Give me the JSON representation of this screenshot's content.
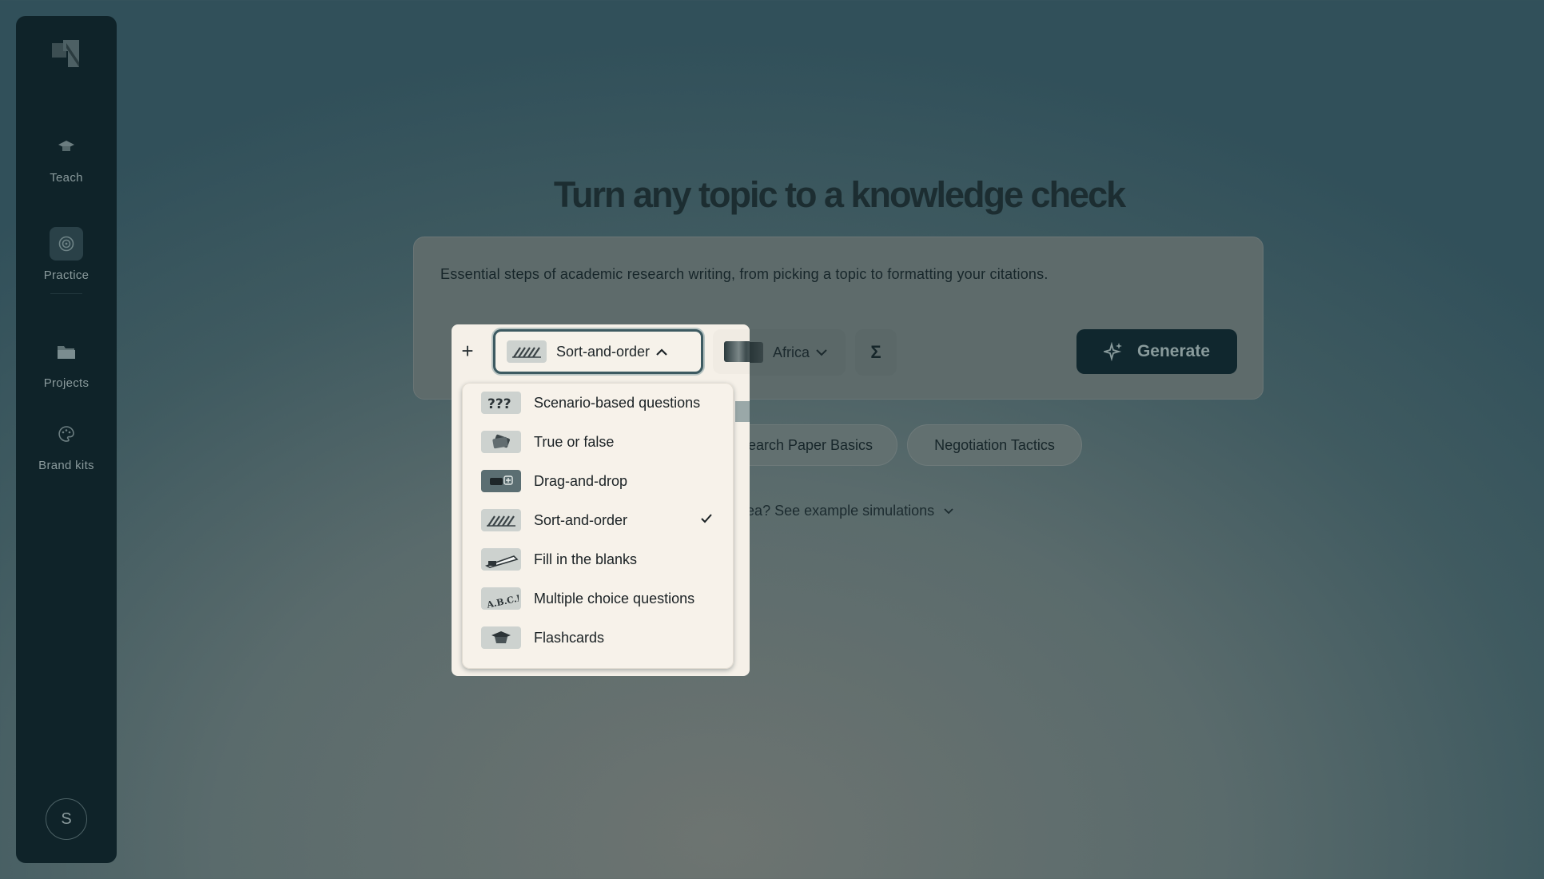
{
  "sidebar": {
    "items": [
      {
        "label": "Teach",
        "icon": "mortarboard-icon"
      },
      {
        "label": "Practice",
        "icon": "target-icon"
      },
      {
        "label": "Projects",
        "icon": "folder-icon"
      },
      {
        "label": "Brand kits",
        "icon": "palette-icon"
      }
    ],
    "active": "Practice",
    "avatar_initial": "S"
  },
  "main": {
    "title": "Turn any topic to a knowledge check",
    "topic_text": "Essential steps of academic research writing, from picking a topic to formatting your citations.",
    "add_button": "+",
    "question_type": "Sort-and-order",
    "language": "Africa",
    "sigma": "Σ",
    "generate_label": "Generate",
    "chips": [
      "search Paper Basics",
      "Negotiation Tactics"
    ],
    "example_link": "d an idea? See example simulations"
  },
  "question_type_menu": {
    "selected": "Sort-and-order",
    "options": [
      {
        "label": "Scenario-based questions",
        "icon": "question-marks-icon"
      },
      {
        "label": "True or false",
        "icon": "cards-icon"
      },
      {
        "label": "Drag-and-drop",
        "icon": "drag-drop-icon"
      },
      {
        "label": "Sort-and-order",
        "icon": "sort-lines-icon"
      },
      {
        "label": "Fill in the blanks",
        "icon": "pen-blank-icon"
      },
      {
        "label": "Multiple choice questions",
        "icon": "abcd-icon"
      },
      {
        "label": "Flashcards",
        "icon": "flashcard-icon"
      }
    ]
  },
  "colors": {
    "sidebar_bg": "#0f2329",
    "generate_bg": "#10272e",
    "popover_bg": "#f5f0e8",
    "select_border": "#3d5a61"
  }
}
